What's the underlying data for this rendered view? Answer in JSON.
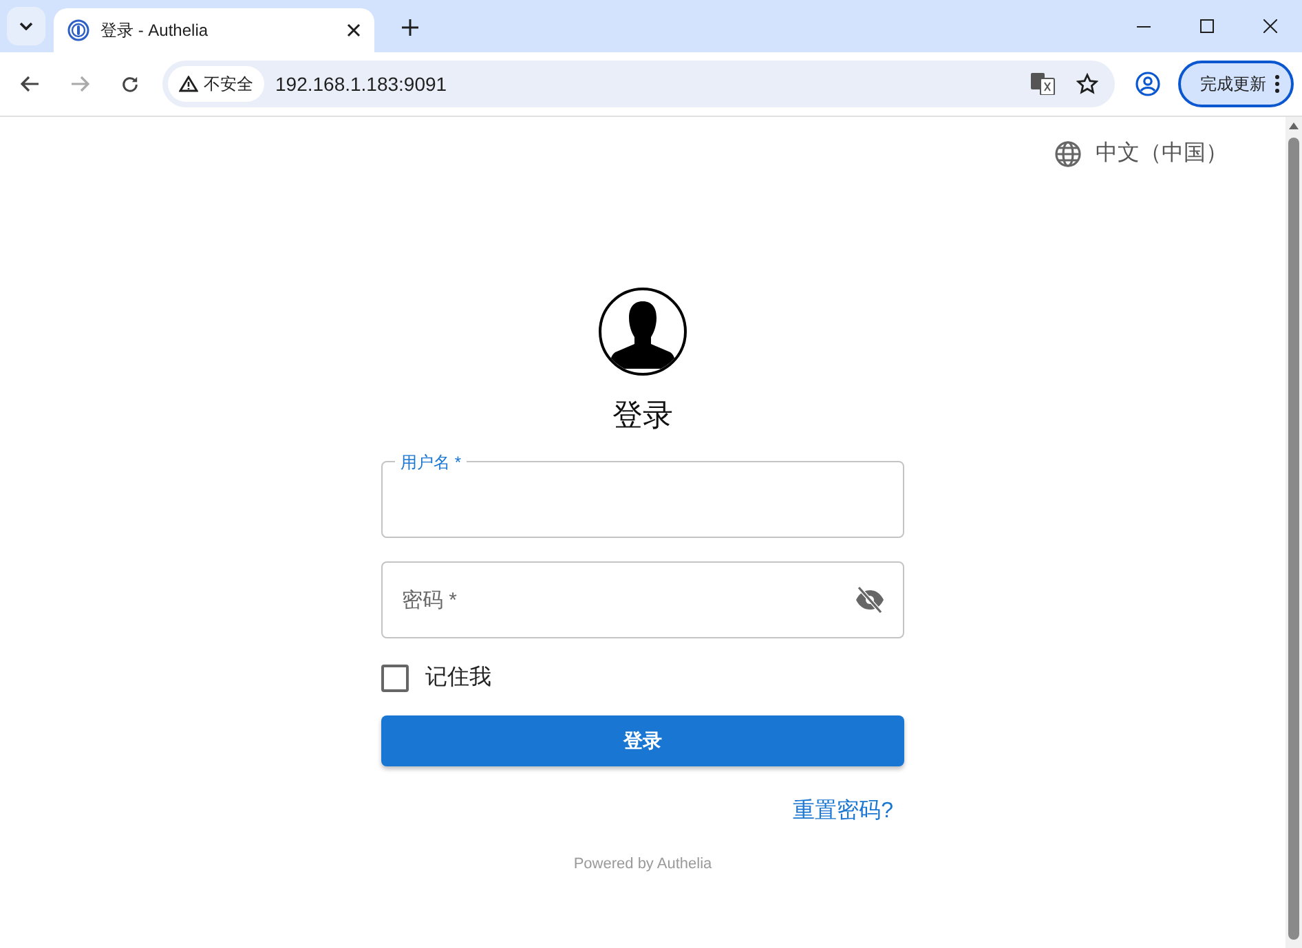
{
  "browser": {
    "tab": {
      "title": "登录 - Authelia",
      "selected": true
    },
    "security_label": "不安全",
    "url": "192.168.1.183:9091",
    "update_button": "完成更新"
  },
  "language": "中文（中国）",
  "title": "登录",
  "username": {
    "label": "用户名 *",
    "focused": true
  },
  "password": {
    "placeholder": "密码 *"
  },
  "remember_me": {
    "label": "记住我",
    "checked": false
  },
  "login_button": "登录",
  "reset_link": "重置密码?",
  "footer": "Powered by Authelia"
}
